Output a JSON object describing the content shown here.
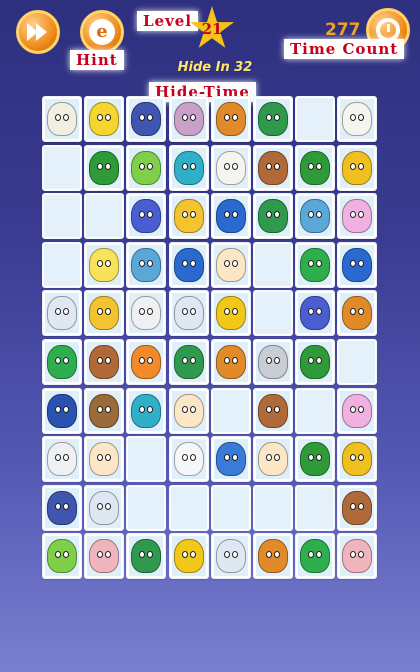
{
  "header": {
    "level_label": "Level",
    "level_value": "21",
    "hint_label": "Hint",
    "hide_in_text": "Hide In 32",
    "hide_time_label": "Hide-Time",
    "time_count_label": "Time Count",
    "time_value": "277"
  },
  "icons": {
    "play": "fast-forward-icon",
    "hint": "hint-e-icon",
    "timer": "timer-icon"
  },
  "tile_colors": {
    "owl": "#f1efe2",
    "cat": "#f6d52e",
    "sheep": "#3f55b0",
    "monkey": "#c9a0c8",
    "lion": "#e08a2a",
    "turtle": "#2f9a4e",
    "lamb": "#f6f4ee",
    "parrot": "#2e9a38",
    "caterpillar": "#7fcf4b",
    "frog": "#2fb0c8",
    "bear": "#b06a3a",
    "bee": "#f0c020",
    "mouse": "#4a5ed0",
    "fox": "#f4c430",
    "dino": "#2a6ad0",
    "seahorse": "#5aa8d8",
    "pig": "#f0b0e0",
    "chick": "#f8e25a",
    "baby": "#fbe6c8",
    "croc": "#2fae4e",
    "butterfly": "#dfe8f2",
    "hen": "#eef0f2",
    "trophy": "#f2c818",
    "dragon": "#f08a2a",
    "rhino": "#c8ccd4",
    "bird": "#2a52b0",
    "cow": "#9a6a3a",
    "mummy": "#f4f6f8",
    "crab": "#3a7ad8",
    "hippo": "#f0b4bc"
  },
  "board": [
    [
      "owl",
      "cat",
      "sheep",
      "monkey",
      "lion",
      "turtle",
      "empty",
      "lamb"
    ],
    [
      "empty",
      "parrot",
      "caterpillar",
      "frog",
      "lamb",
      "bear",
      "parrot",
      "bee"
    ],
    [
      "empty",
      "empty",
      "mouse",
      "fox",
      "dino",
      "turtle",
      "seahorse",
      "pig"
    ],
    [
      "empty",
      "chick",
      "seahorse",
      "dino",
      "baby",
      "empty",
      "croc",
      "dino"
    ],
    [
      "butterfly",
      "fox",
      "hen",
      "butterfly",
      "trophy",
      "empty",
      "mouse",
      "lion"
    ],
    [
      "croc",
      "bear",
      "dragon",
      "turtle",
      "lion",
      "rhino",
      "parrot",
      "empty"
    ],
    [
      "bird",
      "cow",
      "frog",
      "baby",
      "empty",
      "bear",
      "empty",
      "pig"
    ],
    [
      "hen",
      "baby",
      "empty",
      "mummy",
      "crab",
      "baby",
      "parrot",
      "bee"
    ],
    [
      "sheep",
      "butterfly",
      "empty",
      "empty",
      "empty",
      "empty",
      "empty",
      "bear"
    ],
    [
      "caterpillar",
      "hippo",
      "turtle",
      "trophy",
      "butterfly",
      "lion",
      "croc",
      "hippo"
    ]
  ]
}
